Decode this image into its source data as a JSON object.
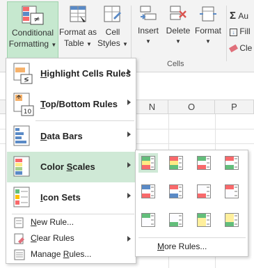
{
  "ribbon": {
    "conditional_formatting": {
      "line1": "Conditional",
      "line2": "Formatting"
    },
    "format_as_table": {
      "line1": "Format as",
      "line2": "Table"
    },
    "cell_styles": {
      "line1": "Cell",
      "line2": "Styles"
    },
    "insert": "Insert",
    "delete": "Delete",
    "format": "Format",
    "cells_group": "Cells",
    "autosum": "Au",
    "fill": "Fill",
    "clear": "Cle"
  },
  "columns": [
    "N",
    "O",
    "P"
  ],
  "menu": {
    "items": [
      {
        "pre": "",
        "ul": "H",
        "post": "ighlight Cells Rules",
        "icon": "highlight-cells-icon",
        "has_submenu": true
      },
      {
        "pre": "",
        "ul": "T",
        "post": "op/Bottom Rules",
        "icon": "top-bottom-icon",
        "icon_text": "10",
        "has_submenu": true
      },
      {
        "pre": "",
        "ul": "D",
        "post": "ata Bars",
        "icon": "data-bars-icon",
        "has_submenu": true
      },
      {
        "pre": "Color ",
        "ul": "S",
        "post": "cales",
        "icon": "color-scales-icon",
        "has_submenu": true,
        "active": true
      },
      {
        "pre": "",
        "ul": "I",
        "post": "con Sets",
        "icon": "icon-sets-icon",
        "has_submenu": true
      }
    ],
    "small_items": [
      {
        "pre": "",
        "ul": "N",
        "post": "ew Rule...",
        "icon": "new-rule-icon"
      },
      {
        "pre": "",
        "ul": "C",
        "post": "lear Rules",
        "icon": "clear-rules-icon",
        "has_submenu": true
      },
      {
        "pre": "Manage ",
        "ul": "R",
        "post": "ules...",
        "icon": "manage-rules-icon"
      }
    ]
  },
  "submenu": {
    "scales": [
      [
        "#63be7b",
        "#ffeb84",
        "#f8696b"
      ],
      [
        "#f8696b",
        "#ffeb84",
        "#63be7b"
      ],
      [
        "#63be7b",
        "#fcfcff",
        "#f8696b"
      ],
      [
        "#f8696b",
        "#fcfcff",
        "#63be7b"
      ],
      [
        "#5a8ac6",
        "#fcfcff",
        "#f8696b"
      ],
      [
        "#f8696b",
        "#fcfcff",
        "#5a8ac6"
      ],
      [
        "#fcfcff",
        "#fcfcff",
        "#f8696b"
      ],
      [
        "#f8696b",
        "#fcfcff",
        "#fcfcff"
      ],
      [
        "#63be7b",
        "#fcfcff",
        "#fcfcff"
      ],
      [
        "#fcfcff",
        "#fcfcff",
        "#63be7b"
      ],
      [
        "#63be7b",
        "#ffef9c",
        "#ffef9c"
      ],
      [
        "#ffef9c",
        "#ffef9c",
        "#63be7b"
      ]
    ],
    "more": {
      "ul": "M",
      "post": "ore Rules..."
    }
  },
  "colors": {
    "active_bg": "#cfe9d6",
    "ribbon_active": "#c6e8cf"
  }
}
